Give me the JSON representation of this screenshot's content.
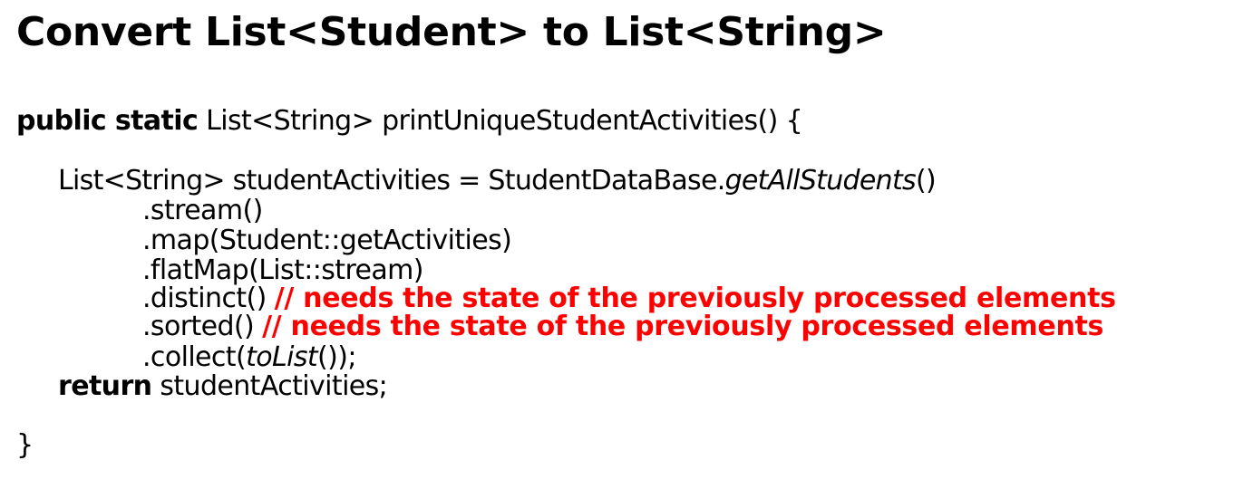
{
  "title": "Convert List<Student> to List<String>",
  "comment_color": "#ff0000",
  "code": {
    "signature": {
      "kw": "public static",
      "rest": " List<String> printUniqueStudentActivities() {"
    },
    "declaration": {
      "lhs": "List<String> studentActivities = StudentDataBase.",
      "method": "getAllStudents",
      "tail": "()"
    },
    "chain": {
      "stream": ".stream()",
      "map": ".map(Student::getActivities)",
      "flatmap": ".flatMap(List::stream)",
      "distinct": ".distinct() ",
      "distinct_comment": "// needs the state of the previously processed elements",
      "sorted": ".sorted() ",
      "sorted_comment": "// needs the state of the previously processed elements",
      "collect_pre": ".collect(",
      "collect_method": "toList",
      "collect_post": "());"
    },
    "return_stmt": {
      "kw": "return",
      "rest": " studentActivities;"
    },
    "closing_brace": "}"
  }
}
